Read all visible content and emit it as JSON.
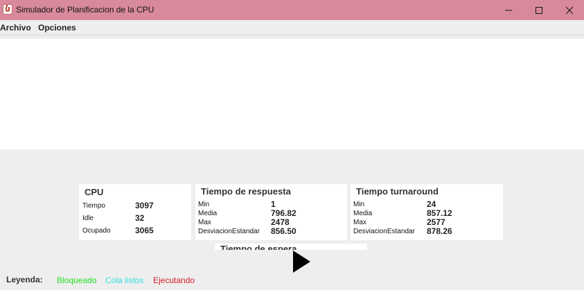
{
  "window": {
    "title": "Simulador de Planificacion de la CPU"
  },
  "menu": {
    "items": [
      "Archivo",
      "Opciones"
    ]
  },
  "cpu_card": {
    "title": "CPU",
    "rows": [
      {
        "label": "Tiempo",
        "value": "3097"
      },
      {
        "label": "Idle",
        "value": "32"
      },
      {
        "label": "Ocupado",
        "value": "3065"
      }
    ]
  },
  "respuesta_card": {
    "title": "Tiempo de respuesta",
    "rows": [
      {
        "label": "Min",
        "value": "1"
      },
      {
        "label": "Media",
        "value": "796.82"
      },
      {
        "label": "Max",
        "value": "2478"
      },
      {
        "label": "DesviacionEstandar",
        "value": "856.50"
      }
    ]
  },
  "turnaround_card": {
    "title": "Tiempo turnaround",
    "rows": [
      {
        "label": "Min",
        "value": "24"
      },
      {
        "label": "Media",
        "value": "857.12"
      },
      {
        "label": "Max",
        "value": "2577"
      },
      {
        "label": "DesviacionEstandar",
        "value": "878.26"
      }
    ]
  },
  "espera_card": {
    "title": "Tiempo de espera"
  },
  "legend": {
    "label": "Leyenda:",
    "items": [
      {
        "text": "Bloqueado",
        "color": "#22e022"
      },
      {
        "text": "Cola listos",
        "color": "#33e0e0"
      },
      {
        "text": "Ejecutando",
        "color": "#d0202a"
      }
    ]
  },
  "controls": {
    "play_icon": "play-icon"
  }
}
